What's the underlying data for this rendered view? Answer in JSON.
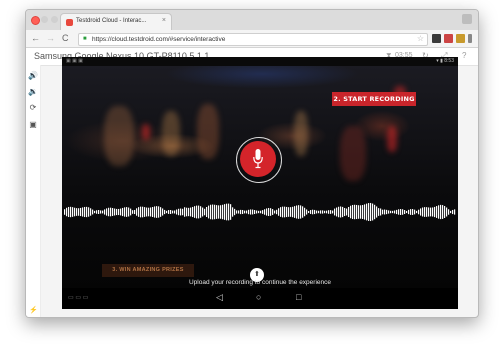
{
  "browser": {
    "tab_title": "Testdroid Cloud - Interac...",
    "tab_close": "×",
    "url": "https://cloud.testdroid.com/#service/interactive",
    "star": "☆",
    "nav_back": "←",
    "nav_forward": "→",
    "nav_reload": "C"
  },
  "page_header": {
    "device_title": "Samsung Google Nexus 10 GT-P8110 5.1.1",
    "timer": "03:55",
    "icons": {
      "refresh": "↻",
      "expand": "⤢",
      "help": "?"
    }
  },
  "rail_icons": {
    "volume_up": "🔊",
    "volume_down": "🔉",
    "rotate": "⟳",
    "camera": "▣",
    "bottom": "⚡"
  },
  "device": {
    "status_right": "▾ ▮ 8:53",
    "status_left": "▣ ▣ ▣",
    "start_recording": "2. START RECORDING",
    "prize_text": "3. WIN AMAZING PRIZES",
    "upload_icon": "⬆",
    "upload_text": "Upload your recording to continue the experience",
    "nav": {
      "back": "◁",
      "home": "○",
      "recents": "□"
    }
  },
  "colors": {
    "accent_red": "#d4242a",
    "badge_red": "#c9252b"
  }
}
